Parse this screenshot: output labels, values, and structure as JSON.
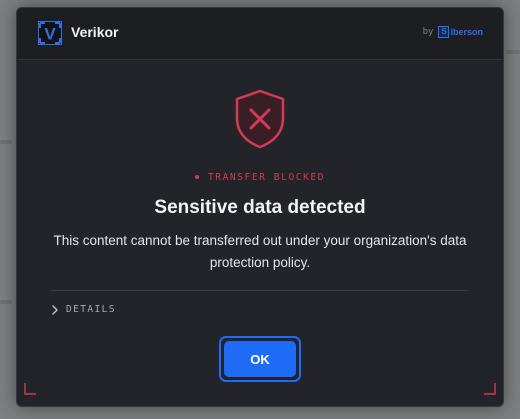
{
  "app": {
    "title": "Verikor",
    "logo_letter": "V",
    "brand_by": "by",
    "brand_initial": "S",
    "brand_name": "iberson"
  },
  "alert": {
    "status": "TRANSFER BLOCKED",
    "headline": "Sensitive data detected",
    "message": "This content cannot be transferred out under your organization's data protection policy."
  },
  "details": {
    "label": "DETAILS",
    "expanded": false
  },
  "actions": {
    "ok_label": "OK",
    "ok_focused": true
  },
  "icons": {
    "shield": "shield-x-icon",
    "chevron": "chevron-right-icon"
  },
  "colors": {
    "dialog_bg": "#22242a",
    "titlebar_bg": "#1c1e22",
    "danger": "#d23a55",
    "primary": "#1e6cf6",
    "brand_blue": "#2f6fe6",
    "text_primary": "#f2f3f5",
    "text_muted": "#a6a9b0"
  }
}
